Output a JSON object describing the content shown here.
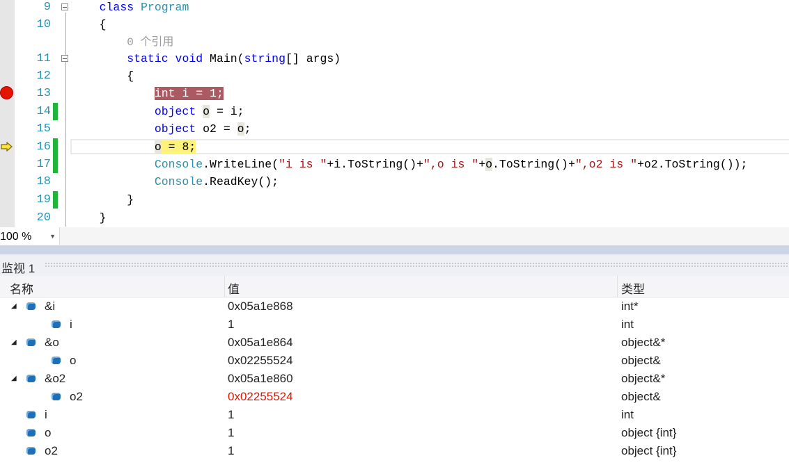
{
  "editor": {
    "lines": [
      {
        "num": "9",
        "fold": true,
        "tokens": [
          [
            "    ",
            ""
          ],
          [
            "class",
            "kw"
          ],
          [
            " ",
            ""
          ],
          [
            "Program",
            "ty"
          ]
        ]
      },
      {
        "num": "10",
        "tokens": [
          [
            "    {",
            ""
          ]
        ]
      },
      {
        "num": "",
        "lens": true,
        "tokens": [
          [
            "        ",
            ""
          ],
          [
            "0 个引用",
            "lens"
          ]
        ]
      },
      {
        "num": "11",
        "fold": true,
        "tokens": [
          [
            "        ",
            ""
          ],
          [
            "static",
            "kw"
          ],
          [
            " ",
            ""
          ],
          [
            "void",
            "kw"
          ],
          [
            " Main(",
            ""
          ],
          [
            "string",
            "kw"
          ],
          [
            "[] args)",
            ""
          ]
        ]
      },
      {
        "num": "12",
        "tokens": [
          [
            "        {",
            ""
          ]
        ]
      },
      {
        "num": "13",
        "tokens": [
          [
            "            ",
            ""
          ],
          [
            "int i = 1;",
            "bp"
          ]
        ]
      },
      {
        "num": "14",
        "chg": true,
        "tokens": [
          [
            "            ",
            ""
          ],
          [
            "object",
            "kw"
          ],
          [
            " ",
            ""
          ],
          [
            "o",
            "ref"
          ],
          [
            " = i;",
            ""
          ]
        ]
      },
      {
        "num": "15",
        "tokens": [
          [
            "            ",
            ""
          ],
          [
            "object",
            "kw"
          ],
          [
            " o2 = ",
            ""
          ],
          [
            "o",
            "ref"
          ],
          [
            ";",
            ""
          ]
        ]
      },
      {
        "num": "16",
        "chg": true,
        "tokens": [
          [
            "            ",
            ""
          ],
          [
            "o",
            "ref"
          ],
          [
            " = 8;",
            "cur"
          ]
        ]
      },
      {
        "num": "17",
        "chg": true,
        "tokens": [
          [
            "            ",
            ""
          ],
          [
            "Console",
            "ty"
          ],
          [
            ".WriteLine(",
            ""
          ],
          [
            "\"i is \"",
            "st"
          ],
          [
            "+i.ToString()+",
            ""
          ],
          [
            "\",o is \"",
            "st"
          ],
          [
            "+",
            ""
          ],
          [
            "o",
            "ref"
          ],
          [
            ".ToString()+",
            ""
          ],
          [
            "\",o2 is \"",
            "st"
          ],
          [
            "+o2.ToString());",
            ""
          ]
        ]
      },
      {
        "num": "18",
        "tokens": [
          [
            "            ",
            ""
          ],
          [
            "Console",
            "ty"
          ],
          [
            ".ReadKey();",
            ""
          ]
        ]
      },
      {
        "num": "19",
        "chg": true,
        "tokens": [
          [
            "        }",
            ""
          ]
        ]
      },
      {
        "num": "20",
        "tokens": [
          [
            "    }",
            ""
          ]
        ]
      }
    ]
  },
  "zoom": {
    "value": "100 %"
  },
  "watch": {
    "title": "监视 1",
    "headers": {
      "name": "名称",
      "value": "值",
      "type": "类型"
    },
    "rows": [
      {
        "name": "&i",
        "value": "0x05a1e868",
        "type": "int*",
        "level": 0,
        "expanded": true
      },
      {
        "name": "i",
        "value": "1",
        "type": "int",
        "level": 1
      },
      {
        "name": "&o",
        "value": "0x05a1e864",
        "type": "object&*",
        "level": 0,
        "expanded": true
      },
      {
        "name": "o",
        "value": "0x02255524",
        "type": "object&",
        "level": 1
      },
      {
        "name": "&o2",
        "value": "0x05a1e860",
        "type": "object&*",
        "level": 0,
        "expanded": true
      },
      {
        "name": "o2",
        "value": "0x02255524",
        "type": "object&",
        "level": 1,
        "changed": true
      },
      {
        "name": "i",
        "value": "1",
        "type": "int",
        "level": 0
      },
      {
        "name": "o",
        "value": "1",
        "type": "object {int}",
        "level": 0
      },
      {
        "name": "o2",
        "value": "1",
        "type": "object {int}",
        "level": 0
      }
    ]
  }
}
